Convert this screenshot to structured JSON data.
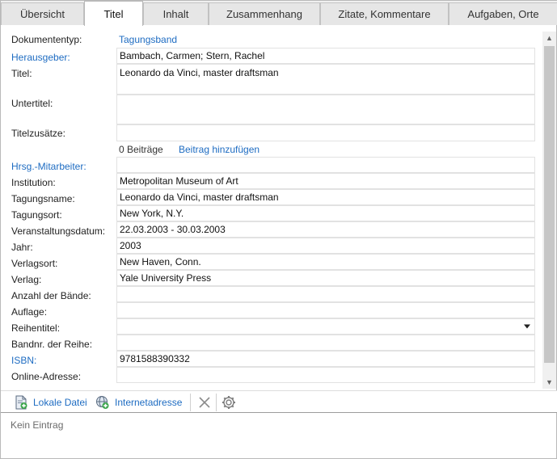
{
  "tabs": [
    {
      "label": "Übersicht"
    },
    {
      "label": "Titel"
    },
    {
      "label": "Inhalt"
    },
    {
      "label": "Zusammenhang"
    },
    {
      "label": "Zitate, Kommentare"
    },
    {
      "label": "Aufgaben, Orte"
    }
  ],
  "form": {
    "dokumenttyp_label": "Dokumententyp:",
    "dokumenttyp_value": "Tagungsband",
    "herausgeber_label": "Herausgeber:",
    "herausgeber_value": "Bambach, Carmen; Stern, Rachel",
    "titel_label": "Titel:",
    "titel_value": "Leonardo da Vinci, master draftsman",
    "untertitel_label": "Untertitel:",
    "untertitel_value": "",
    "titelzusaetze_label": "Titelzusätze:",
    "titelzusaetze_value": "",
    "beitraege_count": "0 Beiträge",
    "beitrag_add": "Beitrag hinzufügen",
    "mitarbeiter_label": "Hrsg.-Mitarbeiter:",
    "mitarbeiter_value": "",
    "institution_label": "Institution:",
    "institution_value": "Metropolitan Museum of Art",
    "tagungsname_label": "Tagungsname:",
    "tagungsname_value": "Leonardo da Vinci, master draftsman",
    "tagungsort_label": "Tagungsort:",
    "tagungsort_value": "New York, N.Y.",
    "datum_label": "Veranstaltungsdatum:",
    "datum_value": "22.03.2003 - 30.03.2003",
    "jahr_label": "Jahr:",
    "jahr_value": "2003",
    "verlagsort_label": "Verlagsort:",
    "verlagsort_value": "New Haven, Conn.",
    "verlag_label": "Verlag:",
    "verlag_value": "Yale University Press",
    "baende_label": "Anzahl der Bände:",
    "baende_value": "",
    "auflage_label": "Auflage:",
    "auflage_value": "",
    "reihentitel_label": "Reihentitel:",
    "reihentitel_value": "",
    "bandnr_label": "Bandnr. der Reihe:",
    "bandnr_value": "",
    "isbn_label": "ISBN:",
    "isbn_value": "9781588390332",
    "online_label": "Online-Adresse:",
    "online_value": ""
  },
  "toolbar": {
    "local_file": "Lokale Datei",
    "internet_address": "Internetadresse",
    "local_file_icon": "document-add-icon",
    "internet_icon": "globe-add-icon",
    "delete_icon": "close-icon",
    "settings_icon": "gear-icon"
  },
  "footer": {
    "empty_text": "Kein Eintrag"
  },
  "colors": {
    "link": "#1e6cc2",
    "active_tab": "#ffffff",
    "inactive_tab": "#e6e6e6"
  }
}
